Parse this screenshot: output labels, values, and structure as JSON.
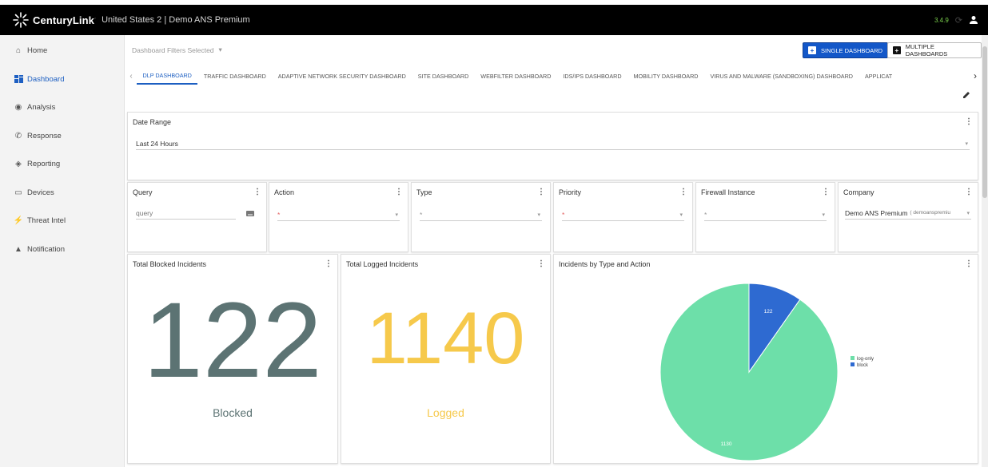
{
  "header": {
    "brand": "CenturyLink",
    "brand_mark": "·",
    "title": "United States 2 | Demo ANS Premium",
    "version": "3.4.9",
    "refresh_icon": "refresh-icon",
    "user_icon": "user-icon"
  },
  "sidebar": {
    "items": [
      {
        "label": "Home",
        "icon": "home-icon"
      },
      {
        "label": "Dashboard",
        "icon": "dashboard-icon"
      },
      {
        "label": "Analysis",
        "icon": "analysis-icon"
      },
      {
        "label": "Response",
        "icon": "response-icon"
      },
      {
        "label": "Reporting",
        "icon": "reporting-icon"
      },
      {
        "label": "Devices",
        "icon": "devices-icon"
      },
      {
        "label": "Threat Intel",
        "icon": "threat-intel-icon"
      },
      {
        "label": "Notification",
        "icon": "notification-icon"
      }
    ]
  },
  "toolbar": {
    "filters_label": "Dashboard Filters Selected",
    "single_dashboard": "SINGLE DASHBOARD",
    "multiple_dashboards": "MULTIPLE DASHBOARDS"
  },
  "tabs": [
    "DLP DASHBOARD",
    "TRAFFIC DASHBOARD",
    "ADAPTIVE NETWORK SECURITY DASHBOARD",
    "SITE DASHBOARD",
    "WEBFILTER DASHBOARD",
    "IDS/IPS DASHBOARD",
    "MOBILITY DASHBOARD",
    "VIRUS AND MALWARE (SANDBOXING) DASHBOARD",
    "APPLICAT"
  ],
  "filters": {
    "date_range": {
      "title": "Date Range",
      "value": "Last 24 Hours"
    },
    "query": {
      "title": "Query",
      "placeholder": "query"
    },
    "action": {
      "title": "Action",
      "value": "*"
    },
    "type": {
      "title": "Type",
      "value": "*"
    },
    "priority": {
      "title": "Priority",
      "value": "*"
    },
    "firewall": {
      "title": "Firewall Instance",
      "value": "*"
    },
    "company": {
      "title": "Company",
      "value": "Demo ANS Premium",
      "suffix": "( demoanspremiu"
    }
  },
  "widgets": {
    "blocked": {
      "title": "Total Blocked Incidents",
      "value": "122",
      "label": "Blocked",
      "color": "#5c7373"
    },
    "logged": {
      "title": "Total Logged Incidents",
      "value": "1140",
      "label": "Logged",
      "color": "#f6c94b"
    },
    "pie_title": "Incidents by Type and Action"
  },
  "chart_data": {
    "type": "pie",
    "title": "Incidents by Type and Action",
    "categories": [
      "log-only",
      "block"
    ],
    "values": [
      1130,
      122
    ],
    "colors": [
      "#6ddfa9",
      "#2e6ad1"
    ],
    "legend": "right"
  },
  "colors": {
    "accent": "#1d5fc2",
    "button_primary": "#1357c8"
  }
}
